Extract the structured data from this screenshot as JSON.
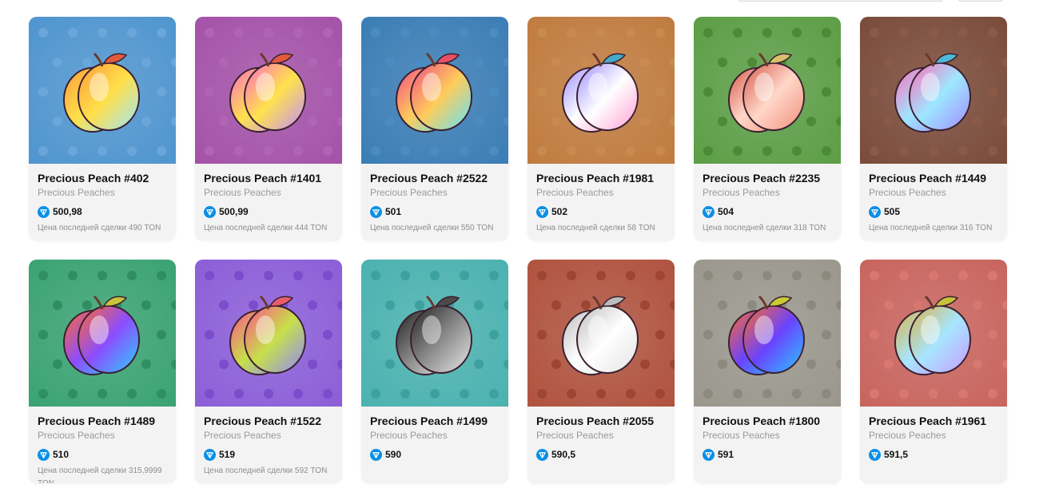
{
  "cards": [
    {
      "title": "Precious Peach #402",
      "collection": "Precious Peaches",
      "price": "500,98",
      "last_sale": "Цена последней сделки 490 TON",
      "bg": "#4f95cf",
      "pattern": "#6aa6da",
      "fruit": [
        "#ff9a3c",
        "#ffe04a",
        "#9de6ff"
      ],
      "leaf": "#e35b3f"
    },
    {
      "title": "Precious Peach #1401",
      "collection": "Precious Peaches",
      "price": "500,99",
      "last_sale": "Цена последней сделки 444 TON",
      "bg": "#a452a8",
      "pattern": "#b065b4",
      "fruit": [
        "#ff69c6",
        "#ffe24c",
        "#c38cff"
      ],
      "leaf": "#e35b3f"
    },
    {
      "title": "Precious Peach #2522",
      "collection": "Precious Peaches",
      "price": "501",
      "last_sale": "Цена последней сделки 550 TON",
      "bg": "#3b7db5",
      "pattern": "#4a8bc2",
      "fruit": [
        "#f04c86",
        "#ffcc5a",
        "#5ee3ff"
      ],
      "leaf": "#e84f62"
    },
    {
      "title": "Precious Peach #1981",
      "collection": "Precious Peaches",
      "price": "502",
      "last_sale": "Цена последней сделки 58 TON",
      "bg": "#c07b3f",
      "pattern": "#c98a4f",
      "fruit": [
        "#9c8dff",
        "#ffffff",
        "#ff9fd3"
      ],
      "leaf": "#46a9c9"
    },
    {
      "title": "Precious Peach #2235",
      "collection": "Precious Peaches",
      "price": "504",
      "last_sale": "Цена последней сделки 318 TON",
      "bg": "#5c9e46",
      "pattern": "#4b8b38",
      "fruit": [
        "#d65a4b",
        "#ffd7c8",
        "#f08f7a"
      ],
      "leaf": "#d9c26e"
    },
    {
      "title": "Precious Peach #1449",
      "collection": "Precious Peaches",
      "price": "505",
      "last_sale": "Цена последней сделки 316 TON",
      "bg": "#7a4b3a",
      "pattern": "#8b5a47",
      "fruit": [
        "#ff6dbb",
        "#9ee7ff",
        "#a38aff"
      ],
      "leaf": "#4fb8d6"
    },
    {
      "title": "Precious Peach #1489",
      "collection": "Precious Peaches",
      "price": "510",
      "last_sale": "Цена последней сделки 315,9999 TON",
      "bg": "#3aa373",
      "pattern": "#2f8f62",
      "fruit": [
        "#ff6a2c",
        "#8c4dff",
        "#2bd1ff"
      ],
      "leaf": "#c9c33a"
    },
    {
      "title": "Precious Peach #1522",
      "collection": "Precious Peaches",
      "price": "519",
      "last_sale": "Цена последней сделки 592 TON",
      "bg": "#8c5ed8",
      "pattern": "#7b4ccb",
      "fruit": [
        "#ff4f8b",
        "#c7e04a",
        "#8f86ff"
      ],
      "leaf": "#e85c6e"
    },
    {
      "title": "Precious Peach #1499",
      "collection": "Precious Peaches",
      "price": "590",
      "last_sale": "",
      "bg": "#4bb2b0",
      "pattern": "#3da19f",
      "fruit": [
        "#222222",
        "#8a8a8a",
        "#e8e8e8"
      ],
      "leaf": "#4a4a4a"
    },
    {
      "title": "Precious Peach #2055",
      "collection": "Precious Peaches",
      "price": "590,5",
      "last_sale": "",
      "bg": "#b0533f",
      "pattern": "#9e4633",
      "fruit": [
        "#bdbdbd",
        "#ffffff",
        "#e2e2e2"
      ],
      "leaf": "#bcbcbc"
    },
    {
      "title": "Precious Peach #1800",
      "collection": "Precious Peaches",
      "price": "591",
      "last_sale": "",
      "bg": "#9a978d",
      "pattern": "#8c897f",
      "fruit": [
        "#ff6b2a",
        "#6a43ff",
        "#2bc8ff"
      ],
      "leaf": "#c9cc34"
    },
    {
      "title": "Precious Peach #1961",
      "collection": "Precious Peaches",
      "price": "591,5",
      "last_sale": "",
      "bg": "#c8645e",
      "pattern": "#d87670",
      "fruit": [
        "#d9b34a",
        "#a7e6ff",
        "#c89bff"
      ],
      "leaf": "#c8c23a"
    }
  ]
}
